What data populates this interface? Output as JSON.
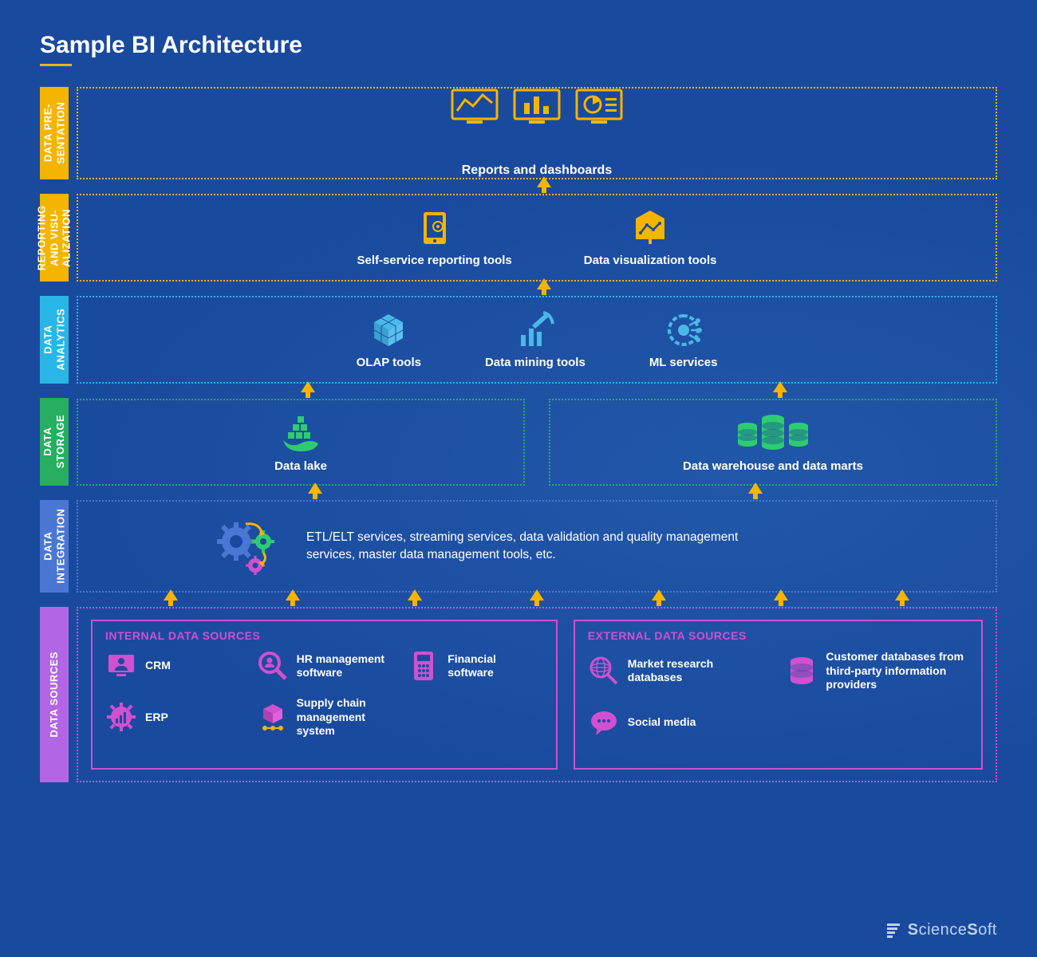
{
  "title": "Sample BI Architecture",
  "logo": "ScienceSoft",
  "layers": {
    "presentation": {
      "label": "DATA PRE-\nSENTATION",
      "caption": "Reports and dashboards"
    },
    "reporting": {
      "label": "REPORTING\nAND VISU-\nALIZATION",
      "items": [
        "Self-service reporting tools",
        "Data visualization tools"
      ]
    },
    "analytics": {
      "label": "DATA\nANALYTICS",
      "items": [
        "OLAP tools",
        "Data mining tools",
        "ML services"
      ]
    },
    "storage": {
      "label": "DATA\nSTORAGE",
      "left": "Data lake",
      "right": "Data warehouse and data marts"
    },
    "integration": {
      "label": "DATA\nINTEGRATION",
      "text": "ETL/ELT services, streaming services, data validation and quality management services, master data management tools, etc."
    },
    "sources": {
      "label": "DATA SOURCES",
      "internal": {
        "title": "INTERNAL DATA SOURCES",
        "items": [
          "CRM",
          "HR management software",
          "Financial software",
          "ERP",
          "Supply chain management system"
        ]
      },
      "external": {
        "title": "EXTERNAL DATA SOURCES",
        "items": [
          "Market research databases",
          "Customer databases from third-party information providers",
          "Social media"
        ]
      }
    }
  },
  "colors": {
    "yellow": "#f5b400",
    "cyan": "#29b6e6",
    "green": "#27ae60",
    "blue": "#4a77d4",
    "purple": "#b266e6",
    "magenta": "#d050d0"
  }
}
